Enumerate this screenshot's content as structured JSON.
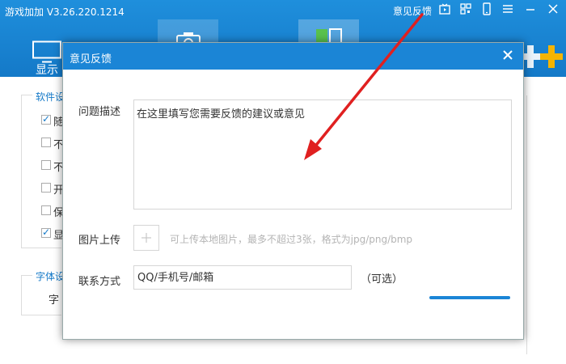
{
  "app": {
    "title": "游戏加加 V3.26.220.1214",
    "feedback_link": "意见反馈",
    "top_icons": [
      "video-icon",
      "qr-code-icon",
      "mobile-icon",
      "menu-icon",
      "minimize-icon",
      "close-icon"
    ]
  },
  "toolbar": {
    "items": [
      {
        "label": "显示",
        "icon": "monitor-icon"
      },
      {
        "label": "",
        "icon": "keyboard-icon"
      },
      {
        "label": "",
        "icon": "camera-icon"
      },
      {
        "label": "",
        "icon": "video-camera-icon"
      },
      {
        "label": "",
        "icon": "window-icon"
      }
    ]
  },
  "background": {
    "software_group_title": "软件设",
    "checkboxes": [
      {
        "text": "随",
        "checked": true
      },
      {
        "text": "不",
        "checked": false
      },
      {
        "text": "不",
        "checked": false
      },
      {
        "text": "开",
        "checked": false
      },
      {
        "text": "保",
        "checked": false
      },
      {
        "text": "显",
        "checked": true
      }
    ],
    "font_group_title": "字体设",
    "font_label": "字"
  },
  "modal": {
    "title": "意见反馈",
    "desc_label": "问题描述",
    "desc_placeholder": "在这里填写您需要反馈的建议或意见",
    "upload_label": "图片上传",
    "upload_hint": "可上传本地图片，最多不超过3张，格式为jpg/png/bmp",
    "contact_label": "联系方式",
    "contact_placeholder": "QQ/手机号/邮箱",
    "optional_label": "（可选）"
  },
  "colors": {
    "header_blue": "#1479c8",
    "modal_header": "#1b85d6",
    "arrow_red": "#e02020"
  }
}
